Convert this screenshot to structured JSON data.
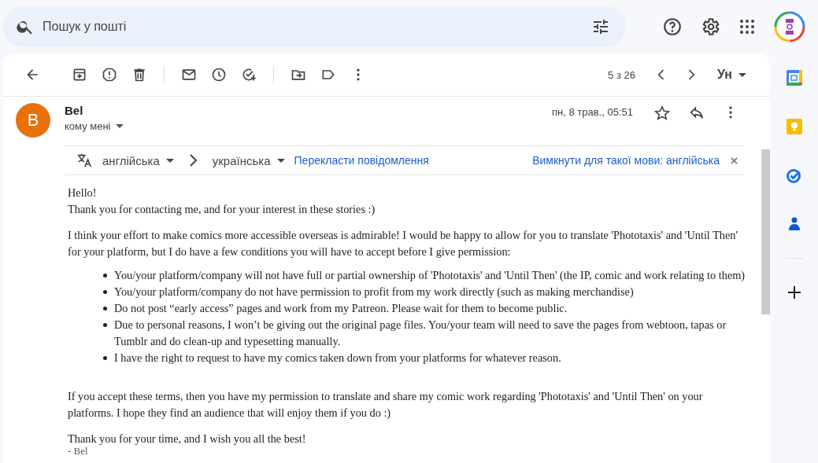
{
  "search": {
    "placeholder": "Пошук у пошті"
  },
  "toolbar": {
    "pagination": "5 з 26",
    "input_tool": "Ун"
  },
  "message": {
    "avatar_letter": "B",
    "sender": "Bel",
    "recipient": "кому мені",
    "date": "пн, 8 трав., 05:51",
    "starred": false
  },
  "translate_bar": {
    "source_language": "англійська",
    "target_language": "українська",
    "translate_link": "Перекласти повідомлення",
    "disable_link": "Вимкнути для такої мови: англійська"
  },
  "body": [
    {
      "kind": "lines",
      "lines": [
        "Hello!",
        "Thank you for contacting me, and for your interest in these stories :)"
      ]
    },
    {
      "kind": "para",
      "text": "I think your effort to make comics more accessible overseas is admirable! I would be happy to allow for you to translate 'Phototaxis' and 'Until Then' for your platform, but I do have a few conditions you will have to accept before I give permission:"
    },
    {
      "kind": "list",
      "items": [
        "You/your platform/company will not have full or partial ownership of 'Phototaxis' and 'Until Then' (the IP, comic and work relating to them)",
        "You/your platform/company do not have permission to profit from my work directly (such as making merchandise)",
        "Do not post “early access” pages and work from my Patreon. Please wait for them to become public.",
        "Due to personal reasons, I won’t be giving out the original page files. You/your team will need to save the pages from webtoon, tapas or Tumblr and do clean-up and typesetting manually.",
        "I have the right to request to have my comics taken down from your platforms for whatever reason."
      ]
    },
    {
      "kind": "para",
      "text": "If you accept these terms, then you have my permission to translate and share my comic work regarding 'Phototaxis' and 'Until Then' on your platforms. I hope they find an audience that will enjoy them if you do :)"
    },
    {
      "kind": "lines",
      "lines": [
        "Thank you for your time, and I wish you all the best!"
      ]
    },
    {
      "kind": "signature",
      "text": "- Bel"
    }
  ]
}
